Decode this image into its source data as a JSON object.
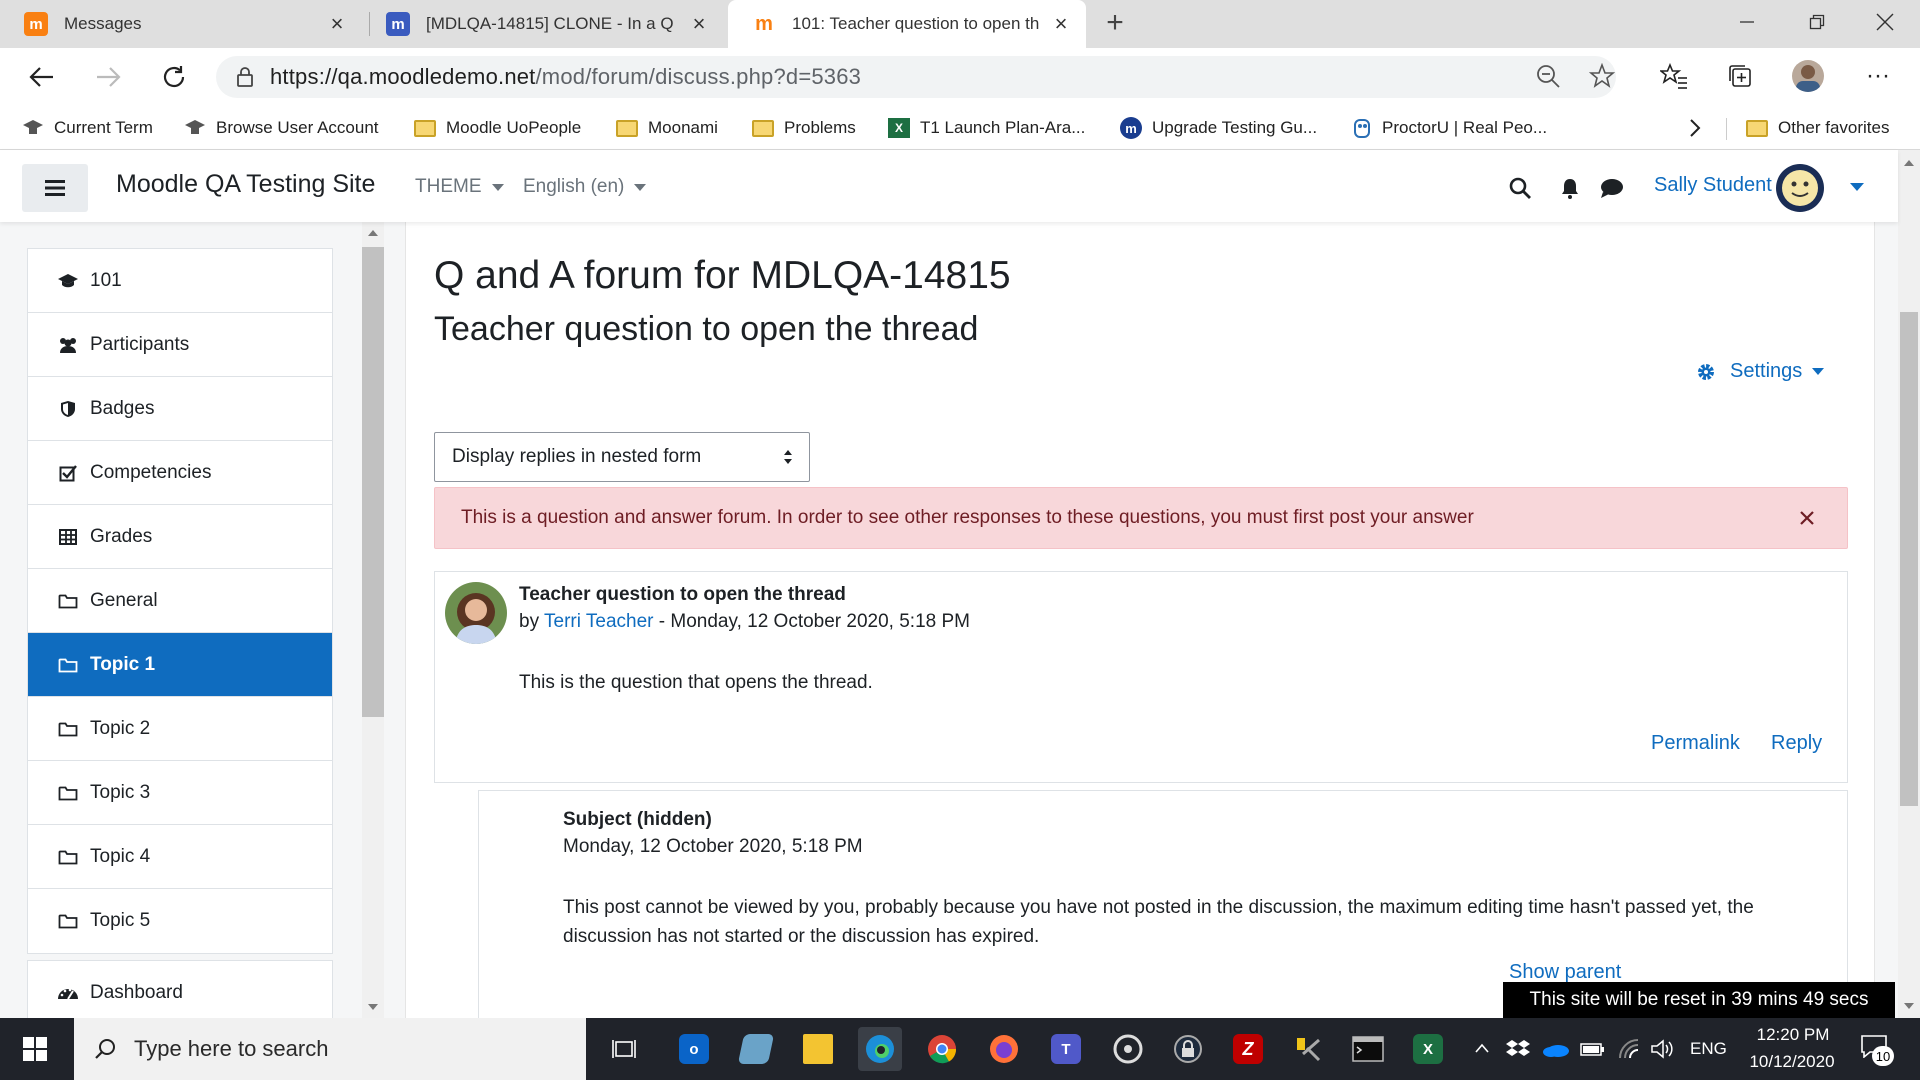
{
  "browser": {
    "tabs": [
      {
        "title": "Messages",
        "favicon": "moodle-orange",
        "active": false
      },
      {
        "title": "[MDLQA-14815] CLONE - In a Q",
        "favicon": "moodle-blue",
        "active": false
      },
      {
        "title": "101: Teacher question to open th",
        "favicon": "moodle-orange",
        "active": true
      }
    ],
    "url_host": "https://qa.moodledemo.net",
    "url_path": "/mod/forum/discuss.php?d=5363",
    "favorites": [
      "Current Term",
      "Browse User Account",
      "Moodle UoPeople",
      "Moonami",
      "Problems",
      "T1 Launch Plan-Ara...",
      "Upgrade Testing Gu...",
      "ProctorU | Real Peo...",
      "Other favorites"
    ]
  },
  "navbar": {
    "site_name": "Moodle QA Testing Site",
    "theme_label": "THEME",
    "language_label": "English (en)",
    "user_name": "Sally Student"
  },
  "drawer": {
    "items": [
      {
        "label": "101",
        "icon": "graduation-cap-icon"
      },
      {
        "label": "Participants",
        "icon": "users-icon"
      },
      {
        "label": "Badges",
        "icon": "shield-icon"
      },
      {
        "label": "Competencies",
        "icon": "checkbox-icon"
      },
      {
        "label": "Grades",
        "icon": "table-icon"
      },
      {
        "label": "General",
        "icon": "folder-icon"
      },
      {
        "label": "Topic 1",
        "icon": "folder-icon",
        "active": true
      },
      {
        "label": "Topic 2",
        "icon": "folder-icon"
      },
      {
        "label": "Topic 3",
        "icon": "folder-icon"
      },
      {
        "label": "Topic 4",
        "icon": "folder-icon"
      },
      {
        "label": "Topic 5",
        "icon": "folder-icon"
      }
    ],
    "dashboard_label": "Dashboard"
  },
  "main": {
    "forum_title": "Q and A forum for MDLQA-14815",
    "discussion_title": "Teacher question to open the thread",
    "settings_label": "Settings",
    "display_mode": "Display replies in nested form",
    "alert_text": "This is a question and answer forum. In order to see other responses to these questions, you must first post your answer",
    "post1": {
      "subject": "Teacher question to open the thread",
      "by_prefix": "by ",
      "author": "Terri Teacher",
      "date": " - Monday, 12 October 2020, 5:18 PM",
      "body": "This is the question that opens the thread.",
      "permalink_label": "Permalink",
      "reply_label": "Reply"
    },
    "post2": {
      "subject": "Subject (hidden)",
      "date": "Monday, 12 October 2020, 5:18 PM",
      "body": "This post cannot be viewed by you, probably because you have not posted in the discussion, the maximum editing time hasn't passed yet, the discussion has not started or the discussion has expired.",
      "show_parent_label": "Show parent"
    },
    "reset_banner": "This site will be reset in 39 mins 49 secs"
  },
  "taskbar": {
    "search_placeholder": "Type here to search",
    "language": "ENG",
    "time": "12:20 PM",
    "date": "10/12/2020",
    "notification_count": "10"
  },
  "colors": {
    "accent": "#0f6cbf",
    "alert_bg": "#f8d7da",
    "alert_text": "#6e1d24",
    "taskbar": "#20232a"
  }
}
